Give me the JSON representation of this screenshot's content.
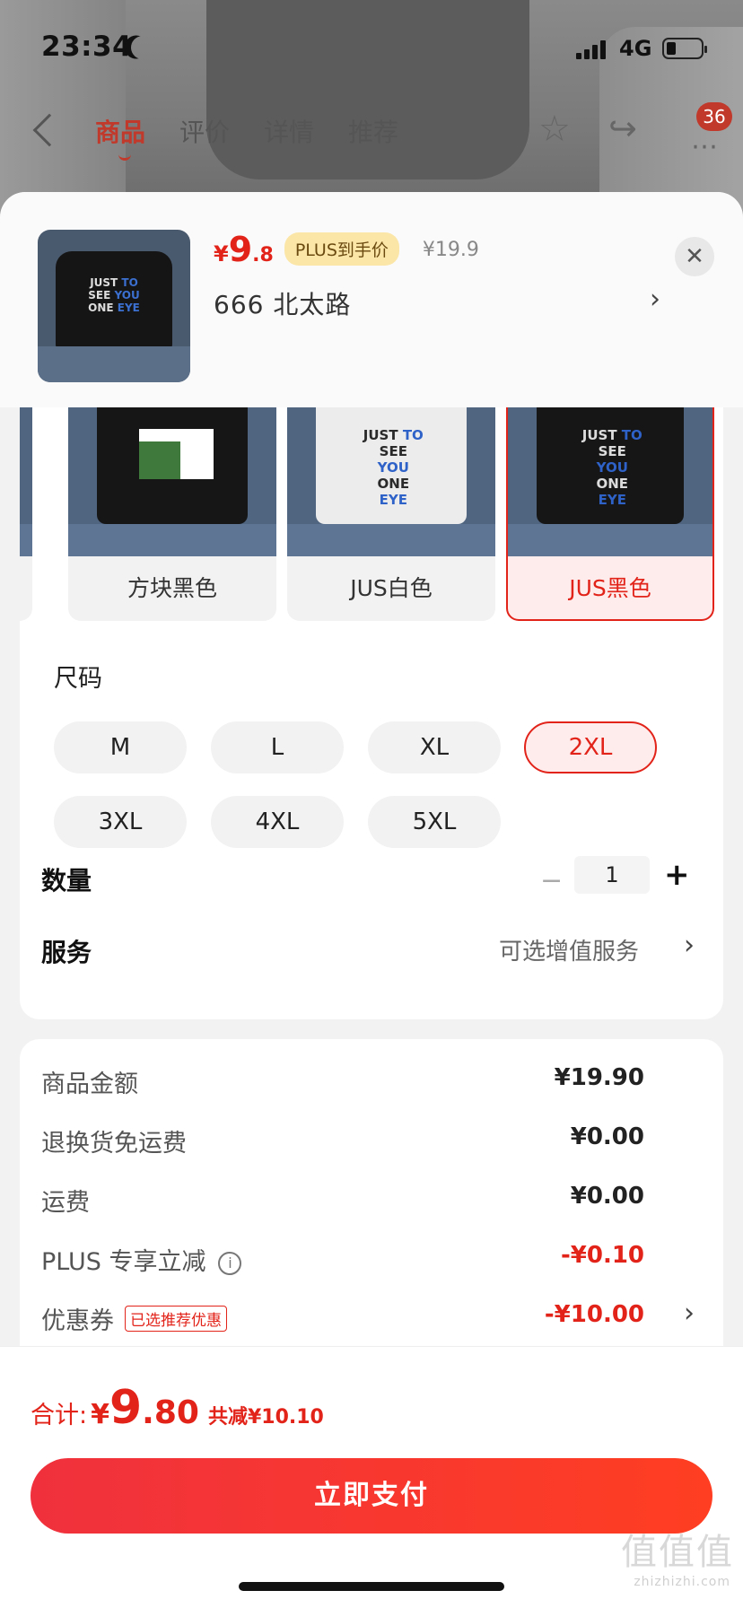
{
  "status_bar": {
    "time": "23:34",
    "network": "4G"
  },
  "nav": {
    "tabs": [
      {
        "label": "商品",
        "active": true
      },
      {
        "label": "评价",
        "active": false
      },
      {
        "label": "详情",
        "active": false
      },
      {
        "label": "推荐",
        "active": false
      }
    ],
    "badge_count": "36"
  },
  "product": {
    "price_yen": "¥",
    "price_int": "9",
    "price_dec": ".8",
    "plus_label": "PLUS到手价",
    "original_price": "¥19.9",
    "selected_spec": "666  北太路"
  },
  "colors": {
    "options": [
      {
        "label": "方块黑色",
        "selected": false
      },
      {
        "label": "JUS白色",
        "selected": false
      },
      {
        "label": "JUS黑色",
        "selected": true
      }
    ]
  },
  "size": {
    "title": "尺码",
    "options": [
      "M",
      "L",
      "XL",
      "2XL",
      "3XL",
      "4XL",
      "5XL"
    ],
    "selected": "2XL"
  },
  "quantity": {
    "label": "数量",
    "minus": "−",
    "value": "1",
    "plus": "+"
  },
  "service": {
    "label": "服务",
    "value": "可选增值服务"
  },
  "summary": {
    "rows": [
      {
        "label": "商品金额",
        "value": "¥19.90"
      },
      {
        "label": "退换货免运费",
        "value": "¥0.00"
      },
      {
        "label": "运费",
        "value": "¥0.00"
      },
      {
        "label": "PLUS 专享立减",
        "value": "-¥0.10"
      },
      {
        "label": "优惠券",
        "tag": "已选推荐优惠",
        "value": "-¥10.00"
      }
    ]
  },
  "total": {
    "label": "合计:",
    "yen": "¥",
    "int": "9",
    "dec": ".80",
    "saved": "共减¥10.10"
  },
  "pay_button": "立即支付",
  "watermark": {
    "main": "值值值",
    "sub": "zhizhizhi.com"
  },
  "colors_theme": {
    "accent": "#e2231a",
    "plus_gold": "#fbe6a8"
  }
}
